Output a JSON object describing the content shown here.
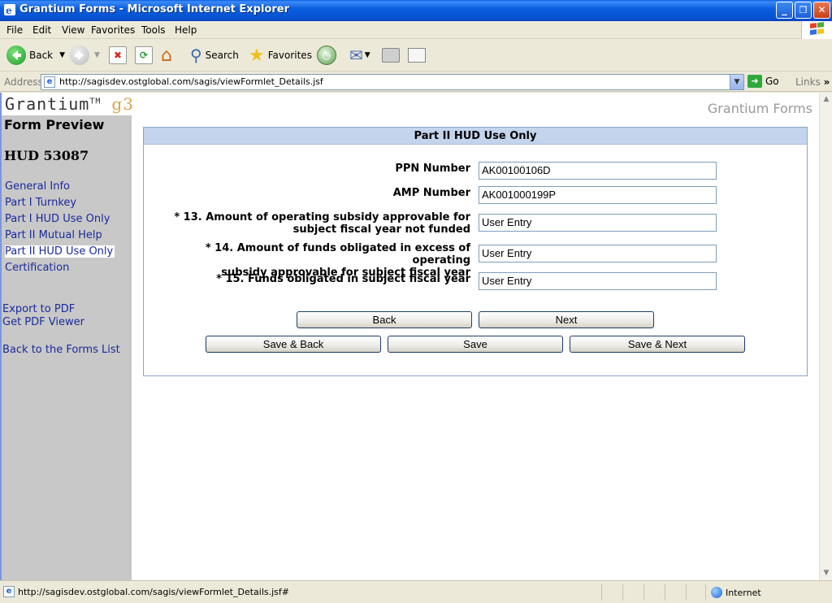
{
  "window": {
    "title": "Grantium Forms - Microsoft Internet Explorer",
    "minimize": "_",
    "maximize": "❐",
    "close": "✕"
  },
  "menu": [
    "File",
    "Edit",
    "View",
    "Favorites",
    "Tools",
    "Help"
  ],
  "toolbar": {
    "back": "Back",
    "search": "Search",
    "favorites": "Favorites"
  },
  "address": {
    "label": "Address",
    "url": "http://sagisdev.ostglobal.com/sagis/viewFormlet_Details.jsf",
    "go": "Go",
    "links": "Links"
  },
  "page": {
    "logo_text": "Grantium",
    "logo_tm": "TM",
    "logo_g3": "g3",
    "brand": "Grantium Forms"
  },
  "sidebar": {
    "heading": "Form Preview",
    "form_id": "HUD 53087",
    "nav": [
      {
        "label": "General Info",
        "active": false
      },
      {
        "label": "Part I Turnkey",
        "active": false
      },
      {
        "label": "Part I HUD Use Only",
        "active": false
      },
      {
        "label": "Part II Mutual Help",
        "active": false
      },
      {
        "label": "Part II HUD Use Only",
        "active": true
      },
      {
        "label": "Certification",
        "active": false
      }
    ],
    "actions": {
      "export_pdf": "Export to PDF",
      "get_pdf_viewer": "Get PDF Viewer",
      "back_to_list": "Back to the Forms List"
    }
  },
  "form": {
    "section_title": "Part II HUD Use Only",
    "fields": [
      {
        "label_line1": "PPN Number",
        "label_line2": "",
        "value": "AK00100106D"
      },
      {
        "label_line1": "AMP Number",
        "label_line2": "",
        "value": "AK001000199P"
      },
      {
        "label_line1": "* 13. Amount of operating subsidy approvable for",
        "label_line2": "subject fiscal year not funded",
        "value": "User Entry"
      },
      {
        "label_line1": "* 14. Amount of funds obligated in excess of operating",
        "label_line2": "subsidy approvable for subject fiscal year",
        "value": "User Entry"
      },
      {
        "label_line1": "* 15. Funds obligated in subject fiscal year",
        "label_line2": "",
        "value": "User Entry"
      }
    ],
    "buttons": {
      "back": "Back",
      "next": "Next",
      "save_back": "Save & Back",
      "save": "Save",
      "save_next": "Save & Next"
    }
  },
  "status": {
    "url": "http://sagisdev.ostglobal.com/sagis/viewFormlet_Details.jsf#",
    "zone": "Internet"
  }
}
